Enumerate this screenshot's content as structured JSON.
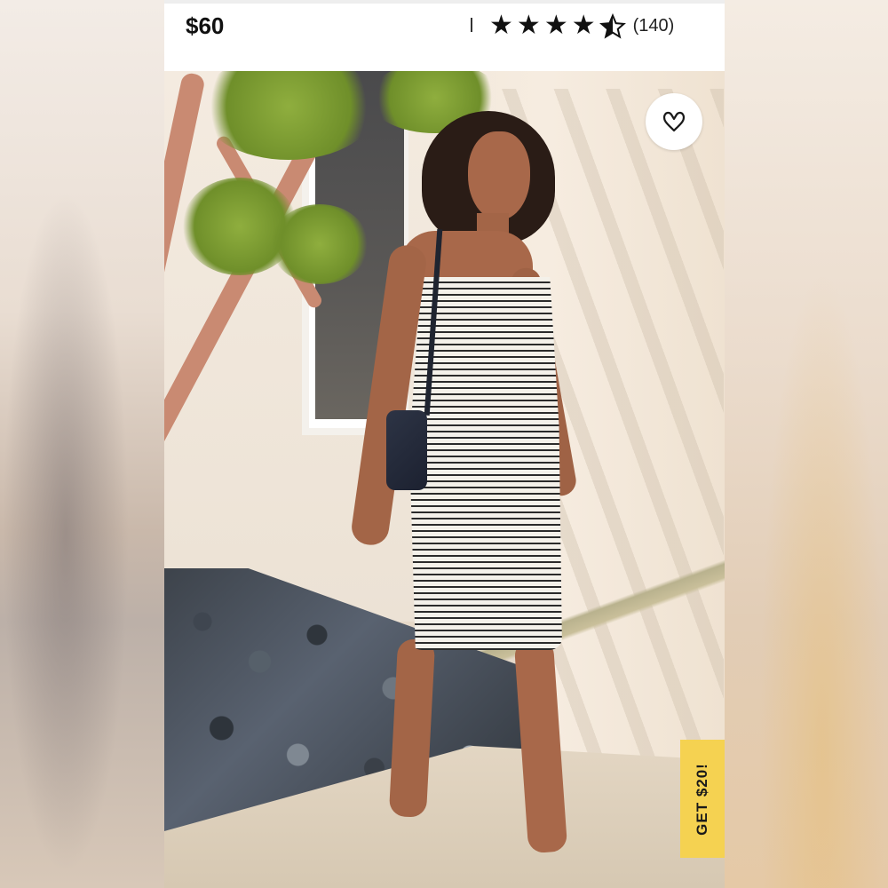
{
  "product": {
    "price": "$60",
    "rating": 4.5,
    "rating_max": 5,
    "review_count": "(140)"
  },
  "icons": {
    "favorite": "heart-outline-icon",
    "star": "star-icon"
  },
  "promo": {
    "label": "GET $20!"
  },
  "colors": {
    "promo_bg": "#f5d251",
    "star": "#111111"
  }
}
